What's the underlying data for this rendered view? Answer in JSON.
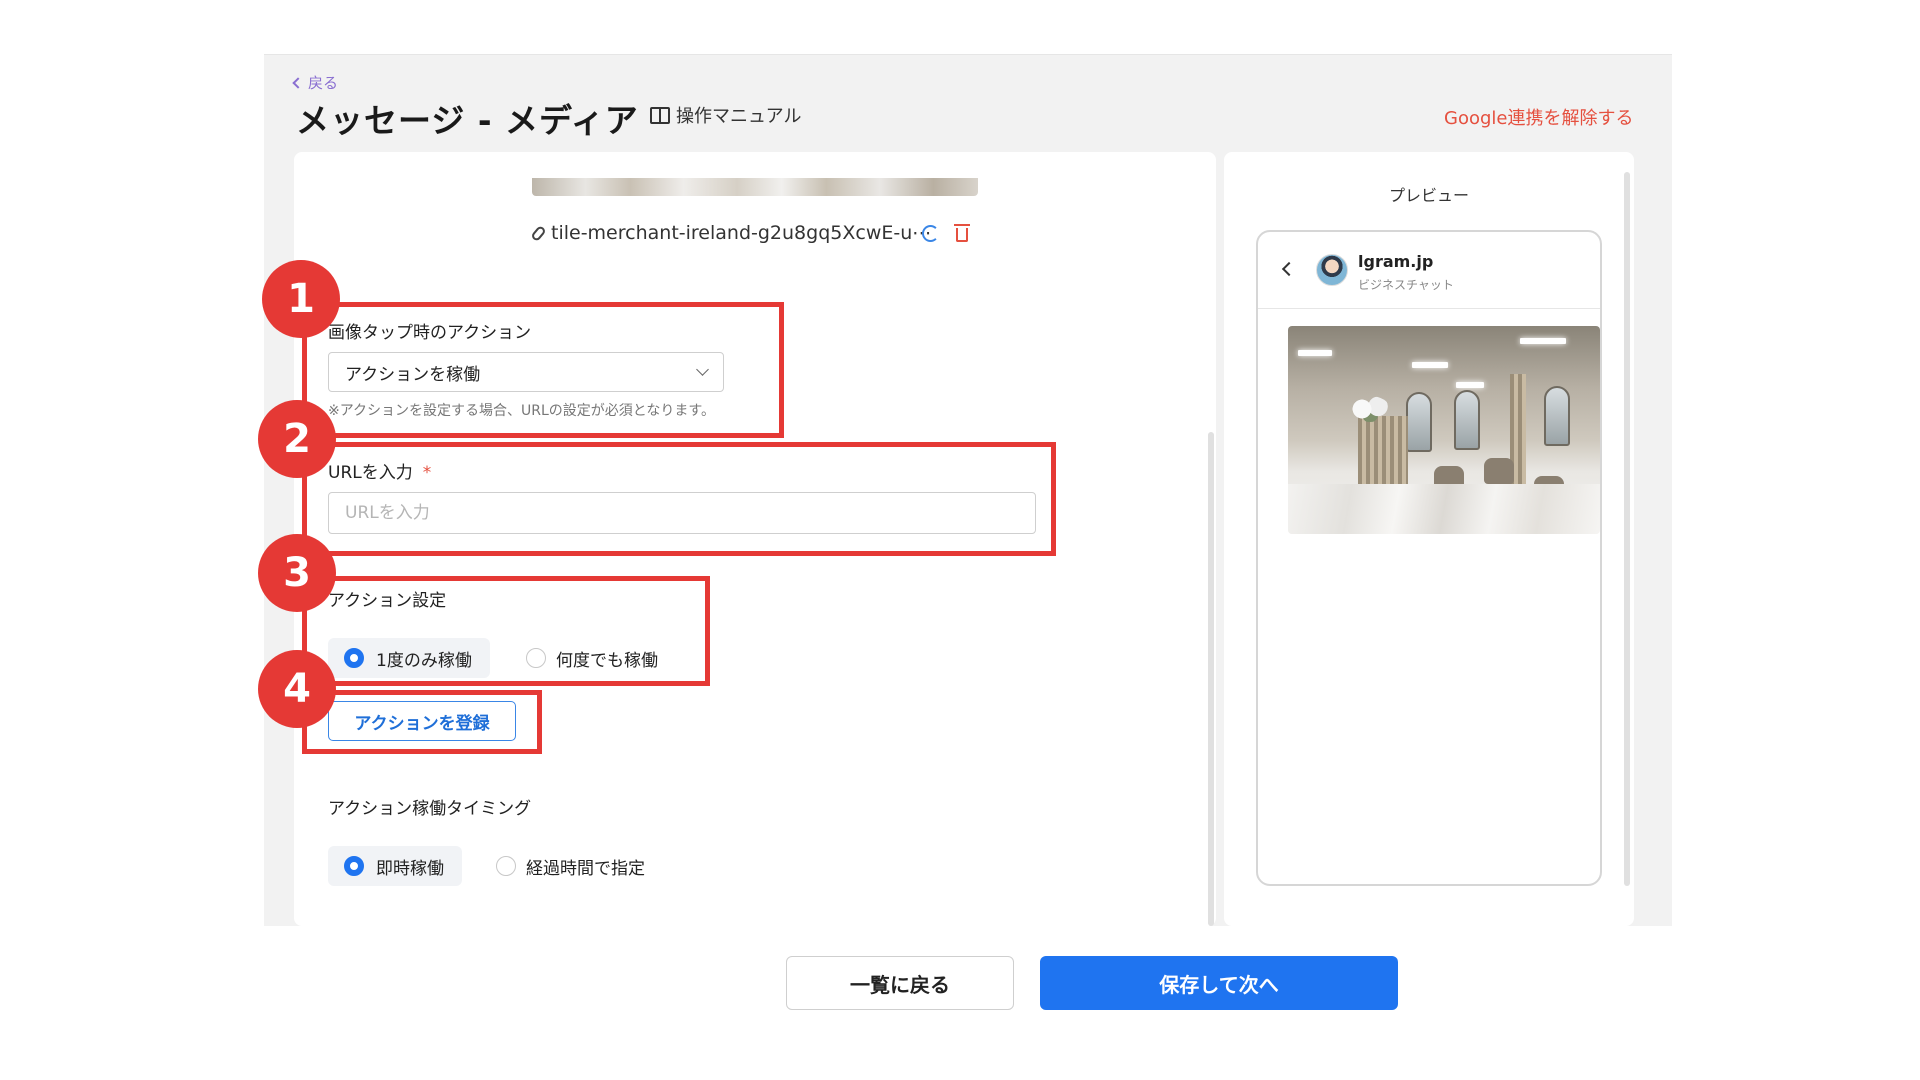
{
  "header": {
    "back_label": "戻る",
    "title": "メッセージ - メディア",
    "manual_label": "操作マニュアル",
    "google_unlink": "Google連携を解除する"
  },
  "media": {
    "filename": "tile-merchant-ireland-g2u8gq5XcwE-u⋯"
  },
  "tap_action": {
    "label": "画像タップ時のアクション",
    "selected": "アクションを稼働",
    "note": "※アクションを設定する場合、URLの設定が必須となります。"
  },
  "url": {
    "label": "URLを入力",
    "required_mark": "*",
    "placeholder": "URLを入力",
    "value": ""
  },
  "action_setting": {
    "label": "アクション設定",
    "options": [
      "1度のみ稼働",
      "何度でも稼働"
    ],
    "selected": "1度のみ稼働"
  },
  "register_button": "アクションを登録",
  "timing": {
    "label": "アクション稼働タイミング",
    "options": [
      "即時稼働",
      "経過時間で指定"
    ],
    "selected": "即時稼働"
  },
  "preview": {
    "title": "プレビュー",
    "account_name": "lgram.jp",
    "account_sub": "ビジネスチャット"
  },
  "annotations": [
    "1",
    "2",
    "3",
    "4"
  ],
  "footer": {
    "back_list": "一覧に戻る",
    "save_next": "保存して次へ"
  },
  "colors": {
    "highlight": "#e53935",
    "primary": "#1f74f0",
    "danger_link": "#e5503f",
    "back_link": "#8a6fd1"
  }
}
